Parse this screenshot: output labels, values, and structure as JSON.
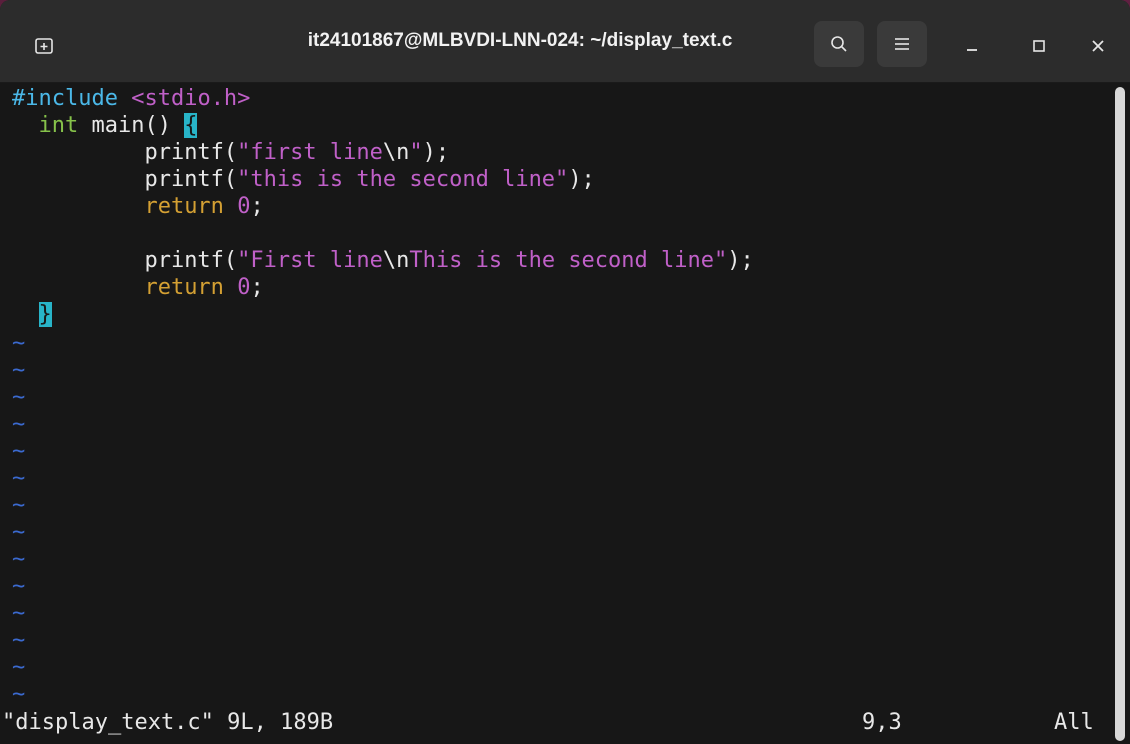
{
  "window": {
    "title": "it24101867@MLBVDI-LNN-024: ~/display_text.c"
  },
  "titlebar_icons": {
    "new_tab": "new-tab-icon",
    "search": "search-icon",
    "menu": "hamburger-menu-icon",
    "minimize": "minimize-icon",
    "maximize": "maximize-icon",
    "close": "close-icon"
  },
  "code": {
    "line1": {
      "directive": "#include",
      "header": "<stdio.h>"
    },
    "line2": {
      "indent": "  ",
      "type": "int",
      "rest": " main() ",
      "brace": "{"
    },
    "line3": {
      "indent": "          ",
      "fn": "printf(",
      "str_a": "\"first line",
      "esc": "\\n",
      "str_b": "\"",
      "end": ");"
    },
    "line4": {
      "indent": "          ",
      "fn": "printf(",
      "str": "\"this is the second line\"",
      "end": ");"
    },
    "line5": {
      "indent": "          ",
      "kw": "return",
      "space": " ",
      "num": "0",
      "end": ";"
    },
    "line7": {
      "indent": "          ",
      "fn": "printf(",
      "str_a": "\"First line",
      "esc": "\\n",
      "str_b": "This is the second line\"",
      "end": ");"
    },
    "line8": {
      "indent": "          ",
      "kw": "return",
      "space": " ",
      "num": "0",
      "end": ";"
    },
    "line9": {
      "indent": "  ",
      "brace": "}"
    }
  },
  "tilde_char": "~",
  "status": {
    "file_info": "\"display_text.c\" 9L, 189B",
    "position": "9,3",
    "scroll": "All"
  }
}
